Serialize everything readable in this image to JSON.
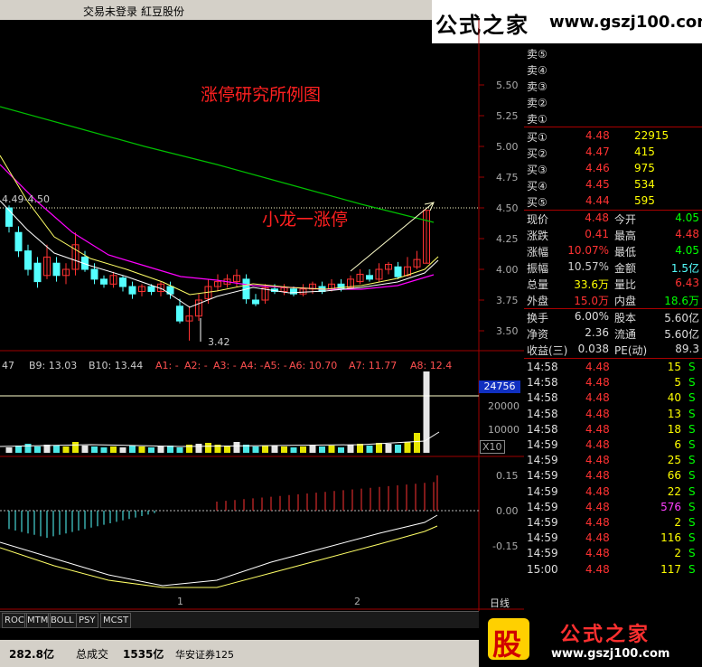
{
  "top_bar": {
    "status": "交易未登录",
    "stock_name": "紅豆股份"
  },
  "watermark_top": {
    "brand": "公式之家",
    "url": "www.gszj100.com"
  },
  "chart": {
    "title_annotation": "涨停研究所例图",
    "limit_up_annotation": "小龙一涨停",
    "high_label": "4.49-4.50",
    "low_label": "3.42",
    "price_axis": [
      "5.50",
      "5.25",
      "5.00",
      "4.75",
      "4.50",
      "4.25",
      "4.00",
      "3.75",
      "3.50"
    ],
    "volume_header": [
      "47",
      "B9: 13.03",
      "B10: 13.44",
      "A1: -",
      "A2: -",
      "A3: -",
      "A4: -",
      "A5: -",
      "A6: 10.70",
      "A7: 11.77",
      "A8: 12.4"
    ],
    "volume_axis": [
      "20000",
      "10000"
    ],
    "volume_value_box": "24756",
    "volume_multiplier": "X10",
    "macd_axis": [
      "0.15",
      "0.00",
      "-0.15"
    ],
    "date_markers": [
      "1",
      "2"
    ],
    "period_label": "日线"
  },
  "colors": {
    "up": "#ff3232",
    "down": "#54ffff",
    "volume_up": "#ffff00",
    "ma_white": "#ffffff",
    "ma_yellow": "#ffff66",
    "ma_magenta": "#ff00ff",
    "ma_green": "#00c000",
    "grid": "#a00000"
  },
  "order_book": {
    "sell": [
      {
        "label": "卖⑤",
        "price": "",
        "volume": ""
      },
      {
        "label": "卖④",
        "price": "",
        "volume": ""
      },
      {
        "label": "卖③",
        "price": "",
        "volume": ""
      },
      {
        "label": "卖②",
        "price": "",
        "volume": ""
      },
      {
        "label": "卖①",
        "price": "",
        "volume": ""
      }
    ],
    "buy": [
      {
        "label": "买①",
        "price": "4.48",
        "volume": "22915"
      },
      {
        "label": "买②",
        "price": "4.47",
        "volume": "415"
      },
      {
        "label": "买③",
        "price": "4.46",
        "volume": "975"
      },
      {
        "label": "买④",
        "price": "4.45",
        "volume": "534"
      },
      {
        "label": "买⑤",
        "price": "4.44",
        "volume": "595"
      }
    ]
  },
  "quote_stats": [
    {
      "l1": "现价",
      "v1": "4.48",
      "c1": "#ff3232",
      "l2": "今开",
      "v2": "4.05",
      "c2": "#00ff00"
    },
    {
      "l1": "涨跌",
      "v1": "0.41",
      "c1": "#ff3232",
      "l2": "最高",
      "v2": "4.48",
      "c2": "#ff3232"
    },
    {
      "l1": "涨幅",
      "v1": "10.07%",
      "c1": "#ff3232",
      "l2": "最低",
      "v2": "4.05",
      "c2": "#00ff00"
    },
    {
      "l1": "振幅",
      "v1": "10.57%",
      "c1": "#cccccc",
      "l2": "金额",
      "v2": "1.5亿",
      "c2": "#54ffff"
    },
    {
      "l1": "总量",
      "v1": "33.6万",
      "c1": "#ffff00",
      "l2": "量比",
      "v2": "6.43",
      "c2": "#ff3232"
    },
    {
      "l1": "外盘",
      "v1": "15.0万",
      "c1": "#ff3232",
      "l2": "内盘",
      "v2": "18.6万",
      "c2": "#00ff00"
    }
  ],
  "fundamentals": [
    {
      "l1": "换手",
      "v1": "6.00%",
      "l2": "股本",
      "v2": "5.60亿"
    },
    {
      "l1": "净资",
      "v1": "2.36",
      "l2": "流通",
      "v2": "5.60亿"
    },
    {
      "l1": "收益(三)",
      "v1": "0.038",
      "l2": "PE(动)",
      "v2": "89.3"
    }
  ],
  "ticks": [
    {
      "time": "14:58",
      "price": "4.48",
      "vol": "15",
      "side": "S"
    },
    {
      "time": "14:58",
      "price": "4.48",
      "vol": "5",
      "side": "S"
    },
    {
      "time": "14:58",
      "price": "4.48",
      "vol": "40",
      "side": "S"
    },
    {
      "time": "14:58",
      "price": "4.48",
      "vol": "13",
      "side": "S"
    },
    {
      "time": "14:58",
      "price": "4.48",
      "vol": "18",
      "side": "S"
    },
    {
      "time": "14:59",
      "price": "4.48",
      "vol": "6",
      "side": "S"
    },
    {
      "time": "14:59",
      "price": "4.48",
      "vol": "25",
      "side": "S"
    },
    {
      "time": "14:59",
      "price": "4.48",
      "vol": "66",
      "side": "S"
    },
    {
      "time": "14:59",
      "price": "4.48",
      "vol": "22",
      "side": "S"
    },
    {
      "time": "14:59",
      "price": "4.48",
      "vol": "576",
      "side": "S"
    },
    {
      "time": "14:59",
      "price": "4.48",
      "vol": "2",
      "side": "S"
    },
    {
      "time": "14:59",
      "price": "4.48",
      "vol": "116",
      "side": "S"
    },
    {
      "time": "14:59",
      "price": "4.48",
      "vol": "2",
      "side": "S"
    },
    {
      "time": "15:00",
      "price": "4.48",
      "vol": "117",
      "side": "S"
    }
  ],
  "indicator_tabs": [
    "ROC",
    "MTM",
    "BOLL",
    "PSY",
    "MCST"
  ],
  "bottom_bar": {
    "amount": "282.8亿",
    "total_label": "总成交",
    "total_value": "1535亿",
    "broker": "华安证券125"
  },
  "watermark_bottom": {
    "glyph": "股",
    "brand": "公式之家",
    "url": "www.gszj100.com"
  }
}
